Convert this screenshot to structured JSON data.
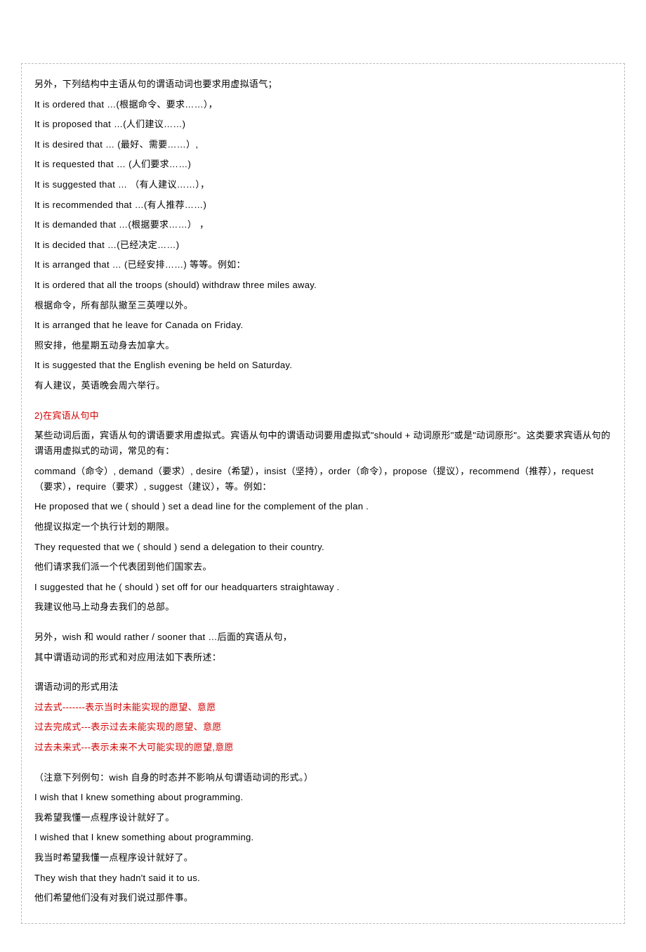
{
  "s1": {
    "intro": "另外，下列结构中主语从句的谓语动词也要求用虚拟语气；",
    "l1": "It is ordered that …(根据命令、要求……），",
    "l2": "It is proposed that …(人们建议……)",
    "l3": "It is desired that … (最好、需要……）,",
    "l4": "It is requested that … (人们要求……)",
    "l5": "It is suggested that … （有人建议……），",
    "l6": "It is recommended that …(有人推荐……)",
    "l7": "It is demanded that …(根据要求……） ，",
    "l8": "It is decided that …(已经决定……)",
    "l9": "It is arranged that … (已经安排……) 等等。例如：",
    "ex1a": "It is ordered that all the troops (should) withdraw three miles away.",
    "ex1b": "根据命令，所有部队撤至三英哩以外。",
    "ex2a": "It is arranged that he leave for Canada on Friday.",
    "ex2b": "照安排，他星期五动身去加拿大。",
    "ex3a": "It is suggested that the English evening be held on Saturday.",
    "ex3b": "有人建议，英语晚会周六举行。"
  },
  "s2": {
    "heading": "2)在宾语从句中",
    "p1": "某些动词后面，宾语从句的谓语要求用虚拟式。宾语从句中的谓语动词要用虚拟式\"should + 动词原形\"或是\"动词原形\"。这类要求宾语从句的谓语用虚拟式的动词，常见的有：",
    "p2": "command（命令）, demand（要求）, desire（希望），insist（坚持），order（命令），propose（提议），recommend（推荐），request（要求），require（要求）, suggest（建议），等。例如：",
    "ex1a": "He proposed that we ( should ) set a dead line for the complement of the plan .",
    "ex1b": "他提议拟定一个执行计划的期限。",
    "ex2a": "They requested that we ( should ) send a delegation to their country.",
    "ex2b": "他们请求我们派一个代表团到他们国家去。",
    "ex3a": "I suggested that he ( should ) set off for our headquarters straightaway .",
    "ex3b": "我建议他马上动身去我们的总部。"
  },
  "s3": {
    "p1": "另外，wish 和 would rather / sooner that …后面的宾语从句，",
    "p2": "其中谓语动词的形式和对应用法如下表所述：",
    "p3": "谓语动词的形式用法",
    "r1": "过去式-------表示当时未能实现的愿望、意愿",
    "r2": "过去完成式---表示过去未能实现的愿望、意愿",
    "r3": "过去未来式---表示未来不大可能实现的愿望,意愿"
  },
  "s4": {
    "note": "（注意下列例句：wish 自身的时态并不影响从句谓语动词的形式。）",
    "ex1a": "I wish that I knew something about programming.",
    "ex1b": "我希望我懂一点程序设计就好了。",
    "ex2a": "I wished that I knew something about programming.",
    "ex2b": "我当时希望我懂一点程序设计就好了。",
    "ex3a": "They wish that they hadn't said it to us.",
    "ex3b": "他们希望他们没有对我们说过那件事。"
  }
}
